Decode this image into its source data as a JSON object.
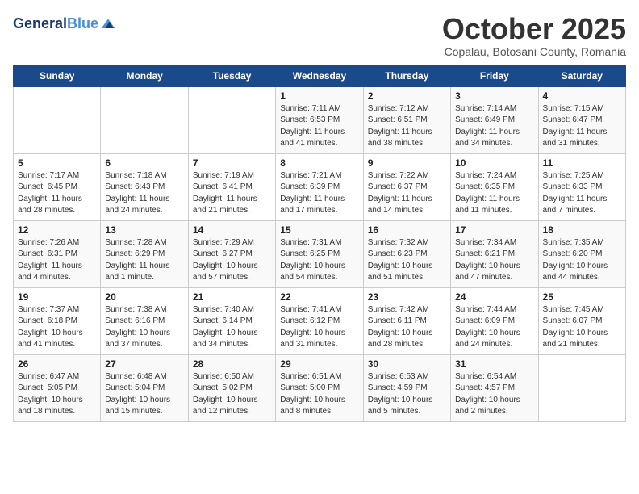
{
  "header": {
    "logo_line1": "General",
    "logo_line2": "Blue",
    "month_title": "October 2025",
    "subtitle": "Copalau, Botosani County, Romania"
  },
  "weekdays": [
    "Sunday",
    "Monday",
    "Tuesday",
    "Wednesday",
    "Thursday",
    "Friday",
    "Saturday"
  ],
  "weeks": [
    [
      {
        "day": "",
        "info": ""
      },
      {
        "day": "",
        "info": ""
      },
      {
        "day": "",
        "info": ""
      },
      {
        "day": "1",
        "info": "Sunrise: 7:11 AM\nSunset: 6:53 PM\nDaylight: 11 hours\nand 41 minutes."
      },
      {
        "day": "2",
        "info": "Sunrise: 7:12 AM\nSunset: 6:51 PM\nDaylight: 11 hours\nand 38 minutes."
      },
      {
        "day": "3",
        "info": "Sunrise: 7:14 AM\nSunset: 6:49 PM\nDaylight: 11 hours\nand 34 minutes."
      },
      {
        "day": "4",
        "info": "Sunrise: 7:15 AM\nSunset: 6:47 PM\nDaylight: 11 hours\nand 31 minutes."
      }
    ],
    [
      {
        "day": "5",
        "info": "Sunrise: 7:17 AM\nSunset: 6:45 PM\nDaylight: 11 hours\nand 28 minutes."
      },
      {
        "day": "6",
        "info": "Sunrise: 7:18 AM\nSunset: 6:43 PM\nDaylight: 11 hours\nand 24 minutes."
      },
      {
        "day": "7",
        "info": "Sunrise: 7:19 AM\nSunset: 6:41 PM\nDaylight: 11 hours\nand 21 minutes."
      },
      {
        "day": "8",
        "info": "Sunrise: 7:21 AM\nSunset: 6:39 PM\nDaylight: 11 hours\nand 17 minutes."
      },
      {
        "day": "9",
        "info": "Sunrise: 7:22 AM\nSunset: 6:37 PM\nDaylight: 11 hours\nand 14 minutes."
      },
      {
        "day": "10",
        "info": "Sunrise: 7:24 AM\nSunset: 6:35 PM\nDaylight: 11 hours\nand 11 minutes."
      },
      {
        "day": "11",
        "info": "Sunrise: 7:25 AM\nSunset: 6:33 PM\nDaylight: 11 hours\nand 7 minutes."
      }
    ],
    [
      {
        "day": "12",
        "info": "Sunrise: 7:26 AM\nSunset: 6:31 PM\nDaylight: 11 hours\nand 4 minutes."
      },
      {
        "day": "13",
        "info": "Sunrise: 7:28 AM\nSunset: 6:29 PM\nDaylight: 11 hours\nand 1 minute."
      },
      {
        "day": "14",
        "info": "Sunrise: 7:29 AM\nSunset: 6:27 PM\nDaylight: 10 hours\nand 57 minutes."
      },
      {
        "day": "15",
        "info": "Sunrise: 7:31 AM\nSunset: 6:25 PM\nDaylight: 10 hours\nand 54 minutes."
      },
      {
        "day": "16",
        "info": "Sunrise: 7:32 AM\nSunset: 6:23 PM\nDaylight: 10 hours\nand 51 minutes."
      },
      {
        "day": "17",
        "info": "Sunrise: 7:34 AM\nSunset: 6:21 PM\nDaylight: 10 hours\nand 47 minutes."
      },
      {
        "day": "18",
        "info": "Sunrise: 7:35 AM\nSunset: 6:20 PM\nDaylight: 10 hours\nand 44 minutes."
      }
    ],
    [
      {
        "day": "19",
        "info": "Sunrise: 7:37 AM\nSunset: 6:18 PM\nDaylight: 10 hours\nand 41 minutes."
      },
      {
        "day": "20",
        "info": "Sunrise: 7:38 AM\nSunset: 6:16 PM\nDaylight: 10 hours\nand 37 minutes."
      },
      {
        "day": "21",
        "info": "Sunrise: 7:40 AM\nSunset: 6:14 PM\nDaylight: 10 hours\nand 34 minutes."
      },
      {
        "day": "22",
        "info": "Sunrise: 7:41 AM\nSunset: 6:12 PM\nDaylight: 10 hours\nand 31 minutes."
      },
      {
        "day": "23",
        "info": "Sunrise: 7:42 AM\nSunset: 6:11 PM\nDaylight: 10 hours\nand 28 minutes."
      },
      {
        "day": "24",
        "info": "Sunrise: 7:44 AM\nSunset: 6:09 PM\nDaylight: 10 hours\nand 24 minutes."
      },
      {
        "day": "25",
        "info": "Sunrise: 7:45 AM\nSunset: 6:07 PM\nDaylight: 10 hours\nand 21 minutes."
      }
    ],
    [
      {
        "day": "26",
        "info": "Sunrise: 6:47 AM\nSunset: 5:05 PM\nDaylight: 10 hours\nand 18 minutes."
      },
      {
        "day": "27",
        "info": "Sunrise: 6:48 AM\nSunset: 5:04 PM\nDaylight: 10 hours\nand 15 minutes."
      },
      {
        "day": "28",
        "info": "Sunrise: 6:50 AM\nSunset: 5:02 PM\nDaylight: 10 hours\nand 12 minutes."
      },
      {
        "day": "29",
        "info": "Sunrise: 6:51 AM\nSunset: 5:00 PM\nDaylight: 10 hours\nand 8 minutes."
      },
      {
        "day": "30",
        "info": "Sunrise: 6:53 AM\nSunset: 4:59 PM\nDaylight: 10 hours\nand 5 minutes."
      },
      {
        "day": "31",
        "info": "Sunrise: 6:54 AM\nSunset: 4:57 PM\nDaylight: 10 hours\nand 2 minutes."
      },
      {
        "day": "",
        "info": ""
      }
    ]
  ]
}
